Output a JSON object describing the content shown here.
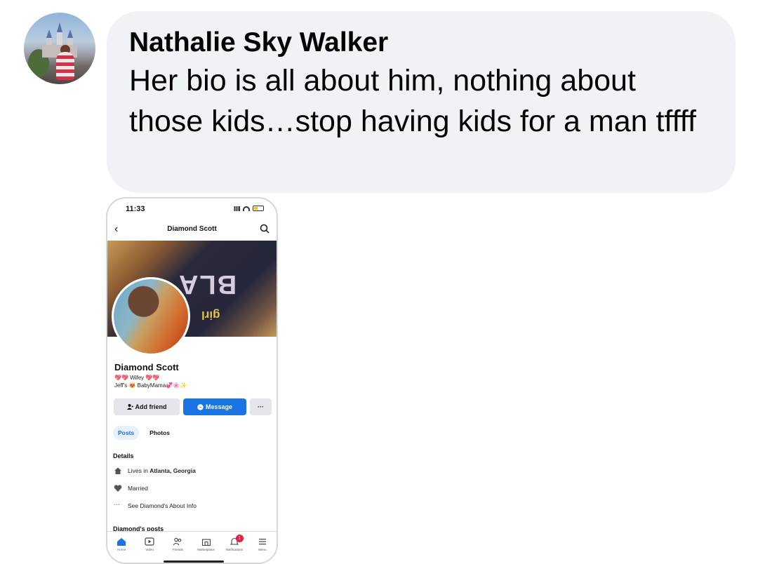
{
  "comment": {
    "author": "Nathalie Sky Walker",
    "text": "Her bio is all about him, nothing about those kids…stop having kids for a man tffff"
  },
  "screenshot": {
    "status_time": "11:33",
    "nav_title": "Diamond Scott",
    "cover_text": "BLA",
    "cover_subtext": "girl",
    "profile": {
      "name": "Diamond Scott",
      "bio_line1": "💖💖 Wifey 💖💖",
      "bio_line2": "Jeff's 😻 BabyMama💞🌸✨"
    },
    "buttons": {
      "add_friend": "Add friend",
      "message": "Message",
      "more": "···"
    },
    "tabs": [
      "Posts",
      "Photos"
    ],
    "details": {
      "heading": "Details",
      "lives_prefix": "Lives in ",
      "lives_place": "Atlanta, Georgia",
      "relationship": "Married",
      "see_about": "See Diamond's About Info"
    },
    "posts_heading": "Diamond's posts",
    "tabbar": {
      "items": [
        "Home",
        "Video",
        "Friends",
        "Marketplace",
        "Notifications",
        "Menu"
      ],
      "notification_count": "1",
      "active": "Home",
      "accent": "#1b74e4"
    }
  }
}
